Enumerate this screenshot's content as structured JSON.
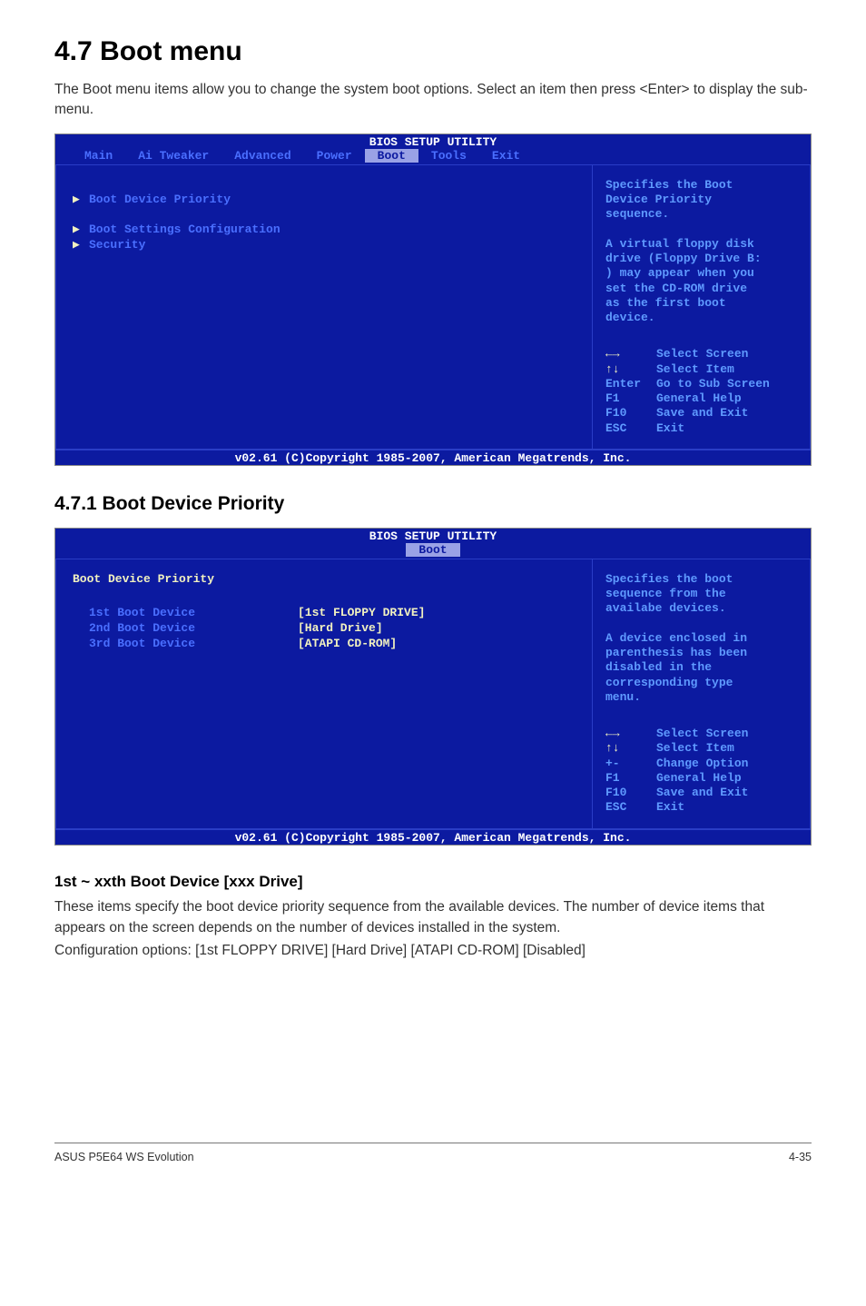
{
  "heading": "4.7     Boot menu",
  "intro": "The Boot menu items allow you to change the system boot options. Select an item then press <Enter> to display the sub-menu.",
  "bios1": {
    "title": "BIOS SETUP UTILITY",
    "tabs": {
      "main": "Main",
      "ai_tweaker": "Ai Tweaker",
      "advanced": "Advanced",
      "power": "Power",
      "boot": "Boot",
      "tools": "Tools",
      "exit": "Exit"
    },
    "left": {
      "item1": "Boot Device Priority",
      "item2": "Boot Settings Configuration",
      "item3": "Security"
    },
    "right": {
      "help": "Specifies the Boot\nDevice Priority\nsequence.\n\nA virtual floppy disk\ndrive (Floppy Drive B:\n) may appear when you\nset the CD-ROM drive\nas the first boot\ndevice.",
      "keys": {
        "arrows_lr": "←→",
        "arrows_lr_label": "Select Screen",
        "arrows_ud": "↑↓",
        "arrows_ud_label": "Select Item",
        "enter": "Enter",
        "enter_label": "Go to Sub Screen",
        "f1": "F1",
        "f1_label": "General Help",
        "f10": "F10",
        "f10_label": "Save and Exit",
        "esc": "ESC",
        "esc_label": "Exit"
      }
    },
    "footer": "v02.61 (C)Copyright 1985-2007, American Megatrends, Inc."
  },
  "subheading": "4.7.1     Boot Device Priority",
  "bios2": {
    "title": "BIOS SETUP UTILITY",
    "tab": "Boot",
    "left": {
      "group": "Boot Device Priority",
      "row1_label": "1st Boot Device",
      "row1_value": "[1st FLOPPY DRIVE]",
      "row2_label": "2nd Boot Device",
      "row2_value": "[Hard Drive]",
      "row3_label": "3rd Boot Device",
      "row3_value": "[ATAPI CD-ROM]"
    },
    "right": {
      "help": "Specifies the boot\nsequence from the\navailabe devices.\n\nA device enclosed in\nparenthesis has been\ndisabled in the\ncorresponding type\nmenu.",
      "keys": {
        "arrows_lr": "←→",
        "arrows_lr_label": "Select Screen",
        "arrows_ud": "↑↓",
        "arrows_ud_label": "Select Item",
        "pm": "+-",
        "pm_label": "Change Option",
        "f1": "F1",
        "f1_label": "General Help",
        "f10": "F10",
        "f10_label": "Save and Exit",
        "esc": "ESC",
        "esc_label": "Exit"
      }
    },
    "footer": "v02.61 (C)Copyright 1985-2007, American Megatrends, Inc."
  },
  "subheading2": "1st ~ xxth Boot Device [xxx Drive]",
  "body1": "These items specify the boot device priority sequence from the available devices. The number of device items that appears on the screen depends on the number of devices installed in the system.",
  "body2": "Configuration options: [1st FLOPPY DRIVE] [Hard Drive] [ATAPI CD-ROM] [Disabled]",
  "footer_left": "ASUS P5E64 WS Evolution",
  "footer_right": "4-35"
}
